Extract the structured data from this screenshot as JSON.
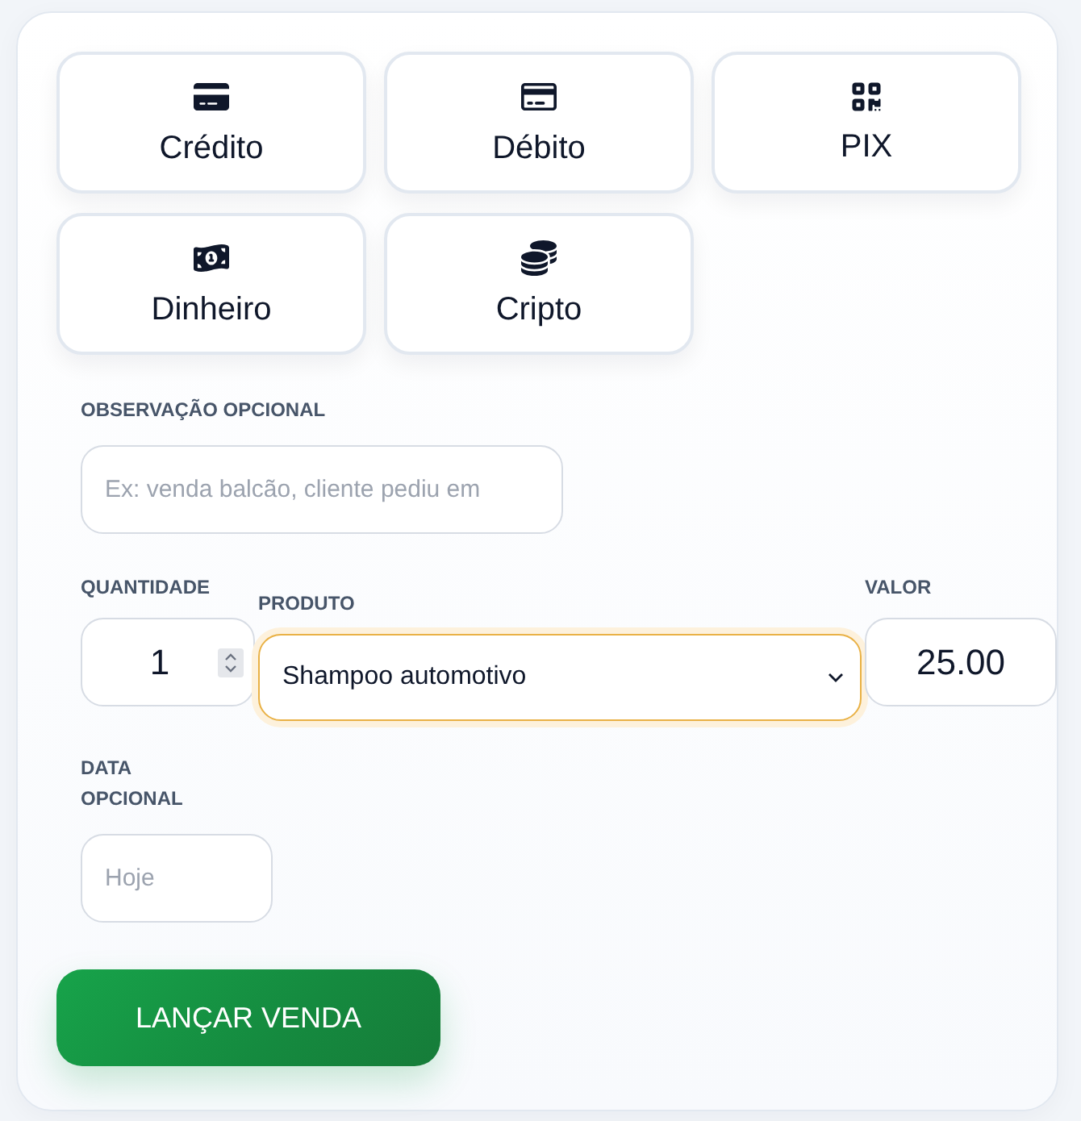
{
  "payment_methods": [
    {
      "label": "Crédito",
      "selected": false
    },
    {
      "label": "Débito",
      "selected": false
    },
    {
      "label": "PIX",
      "selected": false
    },
    {
      "label": "Dinheiro",
      "selected": false
    },
    {
      "label": "Cripto",
      "selected": false
    }
  ],
  "observation": {
    "label": "OBSERVAÇÃO OPCIONAL",
    "placeholder": "Ex: venda balcão, cliente pediu em"
  },
  "quantity": {
    "label": "QUANTIDADE",
    "value": "1"
  },
  "product": {
    "label": "PRODUTO",
    "value": "Shampoo automotivo",
    "focused": true
  },
  "price": {
    "label": "VALOR",
    "value": "25.00"
  },
  "date": {
    "label": "DATA OPCIONAL",
    "placeholder": "Hoje"
  },
  "submit_button": {
    "label": "LANÇAR VENDA"
  }
}
